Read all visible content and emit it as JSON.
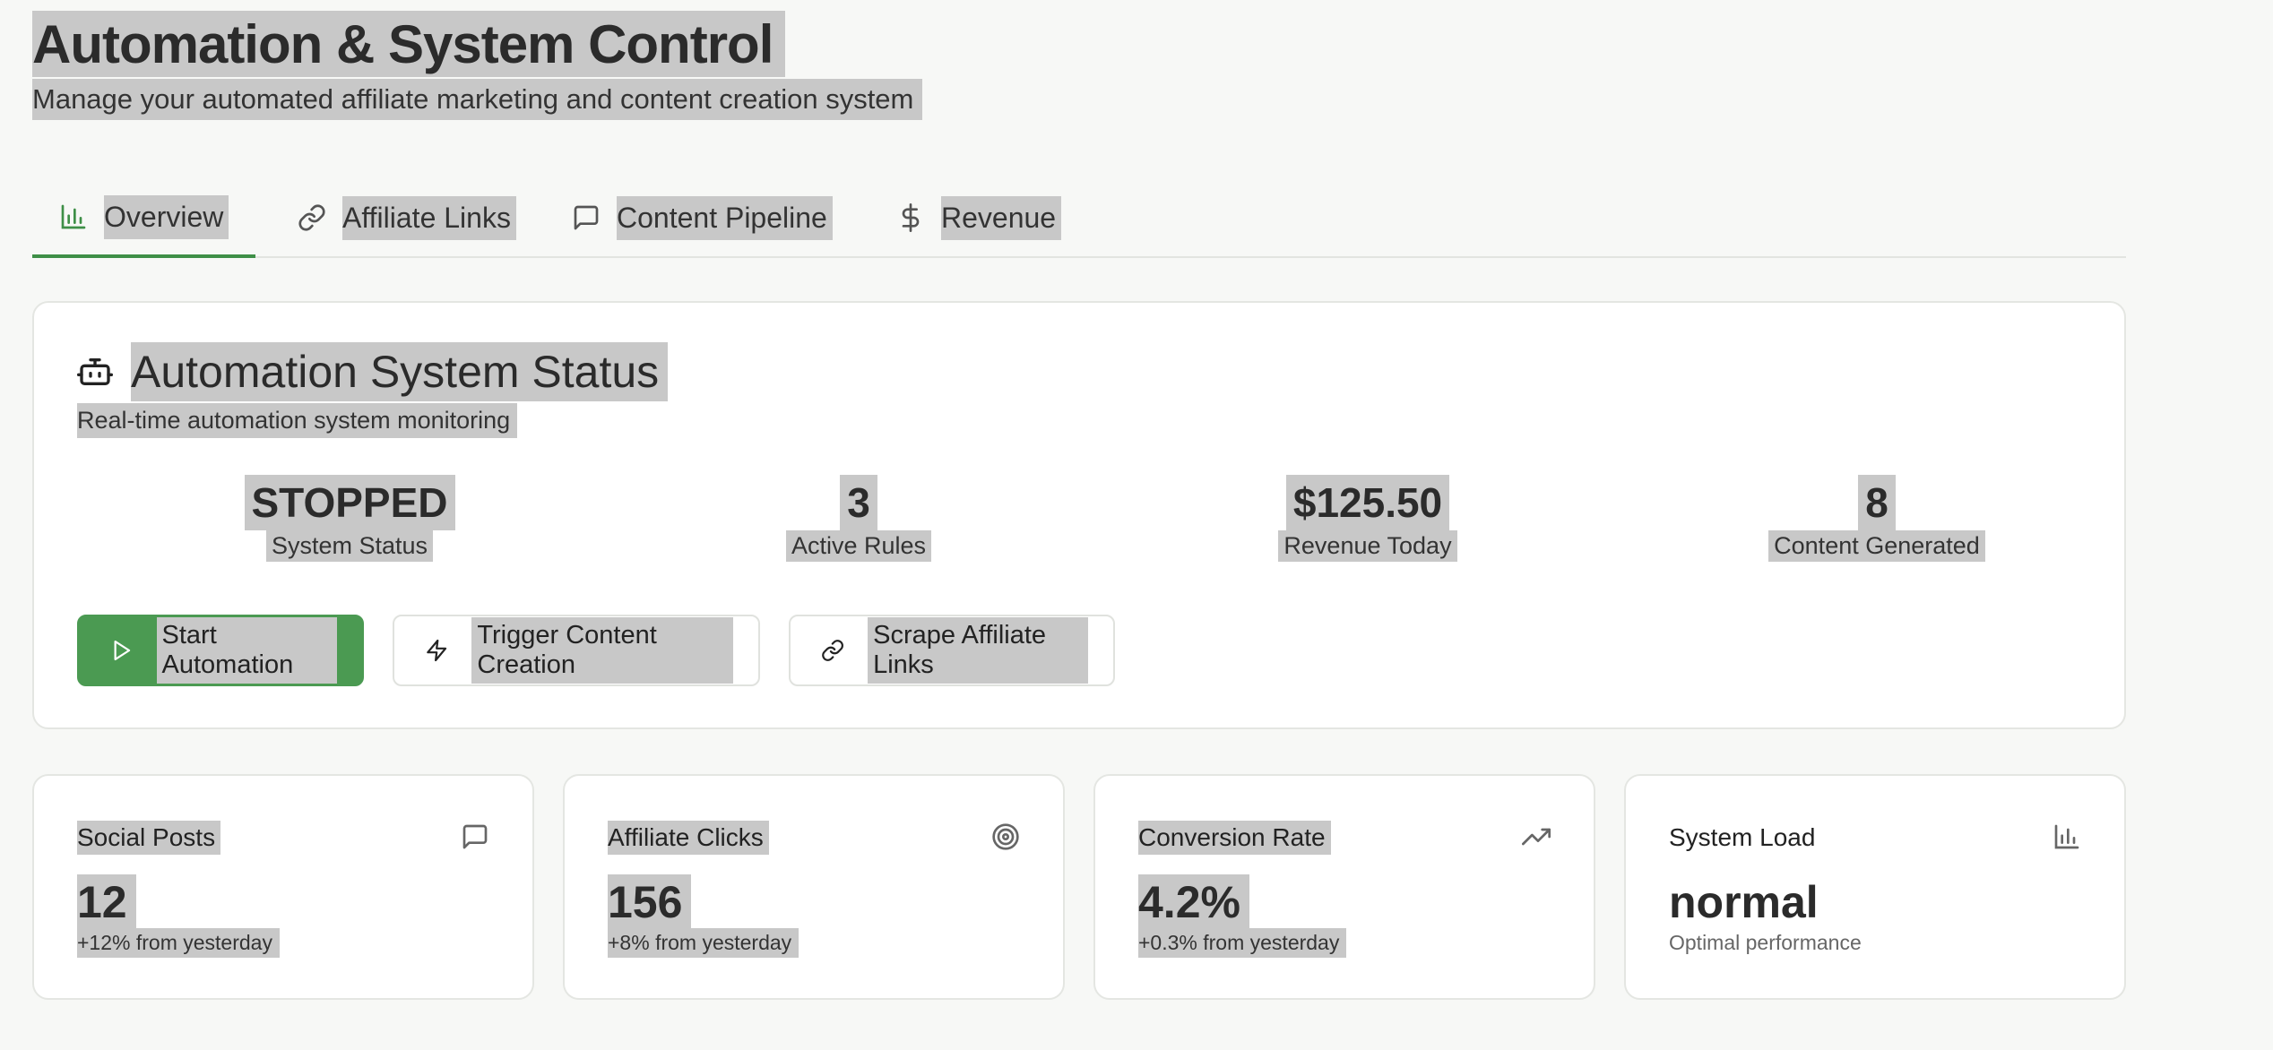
{
  "header": {
    "title": "Automation & System Control",
    "subtitle": "Manage your automated affiliate marketing and content creation system"
  },
  "tabs": [
    {
      "label": "Overview",
      "icon": "bar-chart-icon",
      "active": true
    },
    {
      "label": "Affiliate Links",
      "icon": "link-icon",
      "active": false
    },
    {
      "label": "Content Pipeline",
      "icon": "message-square-icon",
      "active": false
    },
    {
      "label": "Revenue",
      "icon": "dollar-icon",
      "active": false
    }
  ],
  "status_card": {
    "icon": "bot-icon",
    "title": "Automation System Status",
    "description": "Real-time automation system monitoring",
    "metrics": [
      {
        "value": "STOPPED",
        "label": "System Status"
      },
      {
        "value": "3",
        "label": "Active Rules"
      },
      {
        "value": "$125.50",
        "label": "Revenue Today"
      },
      {
        "value": "8",
        "label": "Content Generated"
      }
    ],
    "buttons": {
      "start": {
        "label": "Start Automation",
        "icon": "play-icon"
      },
      "trigger": {
        "label": "Trigger Content Creation",
        "icon": "zap-icon"
      },
      "scrape": {
        "label": "Scrape Affiliate Links",
        "icon": "link-icon"
      }
    }
  },
  "stats": [
    {
      "title": "Social Posts",
      "icon": "message-square-icon",
      "value": "12",
      "sub": "+12% from yesterday"
    },
    {
      "title": "Affiliate Clicks",
      "icon": "target-icon",
      "value": "156",
      "sub": "+8% from yesterday"
    },
    {
      "title": "Conversion Rate",
      "icon": "trending-up-icon",
      "value": "4.2%",
      "sub": "+0.3% from yesterday"
    },
    {
      "title": "System Load",
      "icon": "bar-chart-icon",
      "value": "normal",
      "sub": "Optimal performance"
    }
  ],
  "colors": {
    "accent": "#4b9a52",
    "background": "#f7f8f6",
    "card": "#ffffff",
    "border": "#e4e6e2"
  }
}
